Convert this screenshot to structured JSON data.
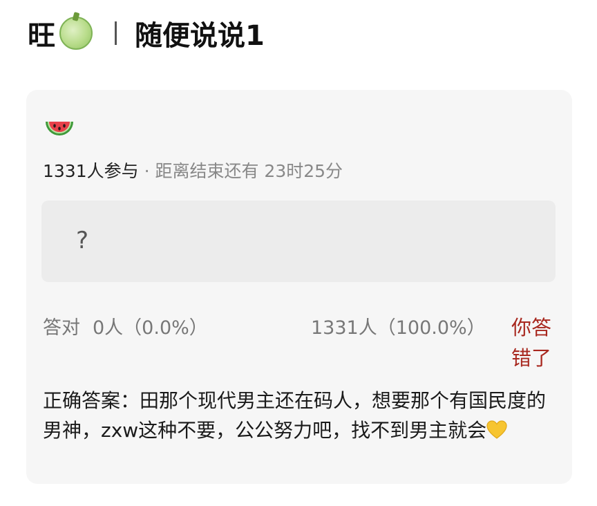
{
  "header": {
    "name": "旺",
    "title": "随便说说1"
  },
  "card": {
    "participants": "1331人参与",
    "separator": " · ",
    "countdown": "距离结束还有 23时25分",
    "question": "?",
    "correct_label": "答对",
    "correct_count": "0人（0.0%）",
    "other_count": "1331人（100.0%）",
    "wrong_label": "你答错了",
    "answer_text": "正确答案：田那个现代男主还在码人，想要那个有国民度的男神，zxw这种不要，公公努力吧，找不到男主就会"
  },
  "icons": {
    "header_emoji": "melon-icon",
    "card_emoji": "watermelon-icon",
    "answer_emoji": "yellow-heart-icon"
  },
  "colors": {
    "wrong": "#a8281f",
    "card_bg": "#f6f6f6",
    "question_bg": "#ececec"
  }
}
